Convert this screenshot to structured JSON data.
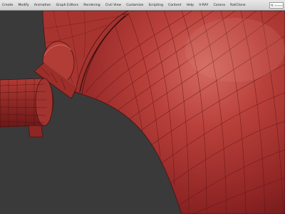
{
  "app": {
    "menu": [
      {
        "label": "Create"
      },
      {
        "label": "Modify"
      },
      {
        "label": "Animation"
      },
      {
        "label": "Graph Editors"
      },
      {
        "label": "Rendering"
      },
      {
        "label": "Civil View"
      },
      {
        "label": "Customize"
      },
      {
        "label": "Scripting"
      },
      {
        "label": "Content"
      },
      {
        "label": "Help"
      },
      {
        "label": "V-RAY"
      },
      {
        "label": "Corona"
      },
      {
        "label": "RailClone"
      }
    ],
    "search": {
      "placeholder": "Search",
      "value": ""
    },
    "icons": {
      "search": "search-icon"
    }
  },
  "viewport": {
    "object_color": "#b43232",
    "wire_color": "#5e1414",
    "background": "#3a3a3a"
  }
}
